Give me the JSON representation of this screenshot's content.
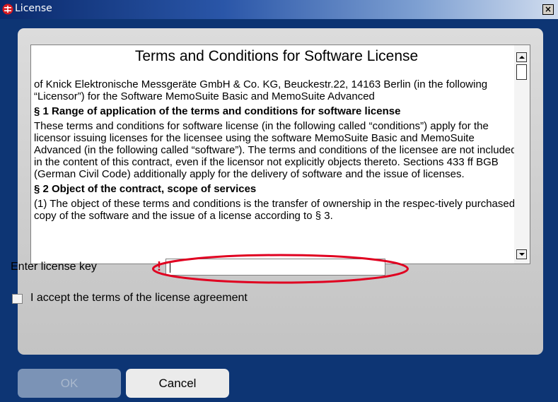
{
  "window": {
    "title": "License",
    "close_glyph": "×"
  },
  "license": {
    "heading": "Terms and Conditions for Software License",
    "paragraphs": [
      {
        "type": "p",
        "text": "of Knick Elektronische Messgeräte GmbH & Co. KG, Beuckestr.22, 14163 Berlin (in the following “Licensor”) for the Software MemoSuite Basic and MemoSuite Advanced"
      },
      {
        "type": "h",
        "text": "§ 1 Range of application of the terms and conditions for software license"
      },
      {
        "type": "p",
        "text": "These terms and conditions for software license (in the following called “conditions”) apply for the licensor issuing licenses for the licensee using the software MemoSuite Basic and MemoSuite Advanced (in the following called “software”). The terms and conditions of the licensee are not included in the content of this contract, even if the licensor not explicitly objects thereto. Sections 433 ff BGB (German Civil Code) additionally apply for the delivery of software and the issue of licenses."
      },
      {
        "type": "h",
        "text": "§ 2 Object of the contract, scope of services"
      },
      {
        "type": "p",
        "text": "(1) The object of these terms and conditions is the transfer of ownership in the respec-tively purchased copy of the software and the issue of a license according to § 3."
      }
    ]
  },
  "form": {
    "key_label": "Enter license key",
    "warning_mark": "!",
    "key_value": "",
    "accept_label": "I accept the terms of the license agreement",
    "accept_checked": false
  },
  "buttons": {
    "ok_label": "OK",
    "cancel_label": "Cancel",
    "ok_enabled": false
  },
  "colors": {
    "background": "#0d3574",
    "panel": "#c8c8c8",
    "highlight_ellipse": "#e00020",
    "warning": "#e0001a"
  }
}
